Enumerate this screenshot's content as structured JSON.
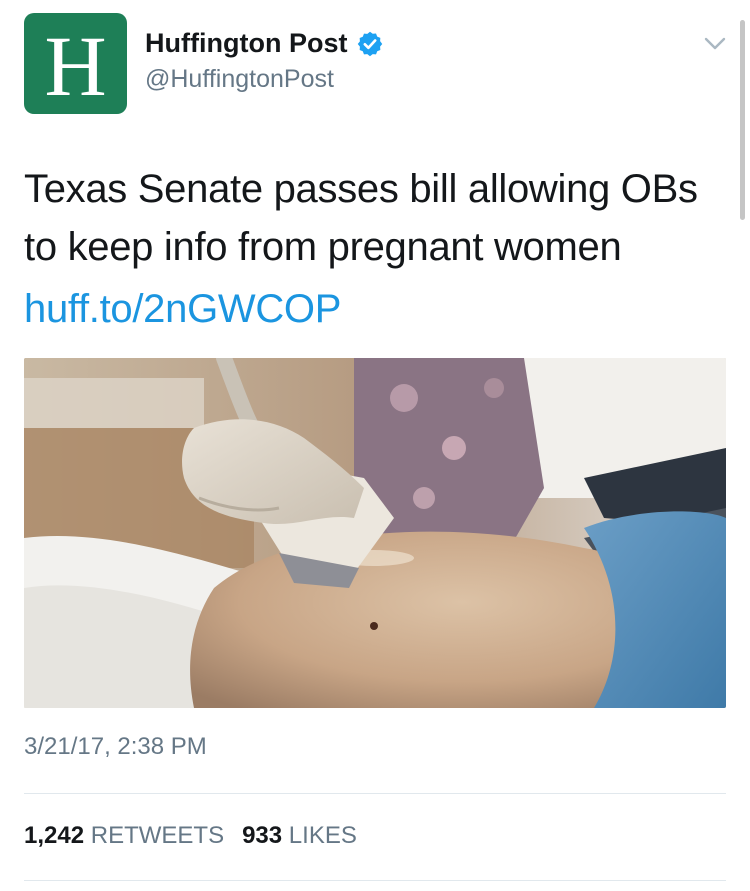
{
  "account": {
    "avatar_letter": "H",
    "avatar_color": "#1e7f57",
    "display_name": "Huffington Post",
    "handle": "@HuffingtonPost",
    "verified": true,
    "verified_icon": "verified-badge-icon",
    "menu_icon": "chevron-down-icon"
  },
  "tweet": {
    "text": "Texas Senate passes bill allowing OBs to keep info from pregnant women",
    "link": "huff.to/2nGWCOP",
    "link_color": "#1b95e0",
    "image_description_icon": "photo",
    "timestamp": "3/21/17, 2:38 PM"
  },
  "stats": {
    "retweets_count": "1,242",
    "retweets_label": "RETWEETS",
    "likes_count": "933",
    "likes_label": "LIKES"
  }
}
